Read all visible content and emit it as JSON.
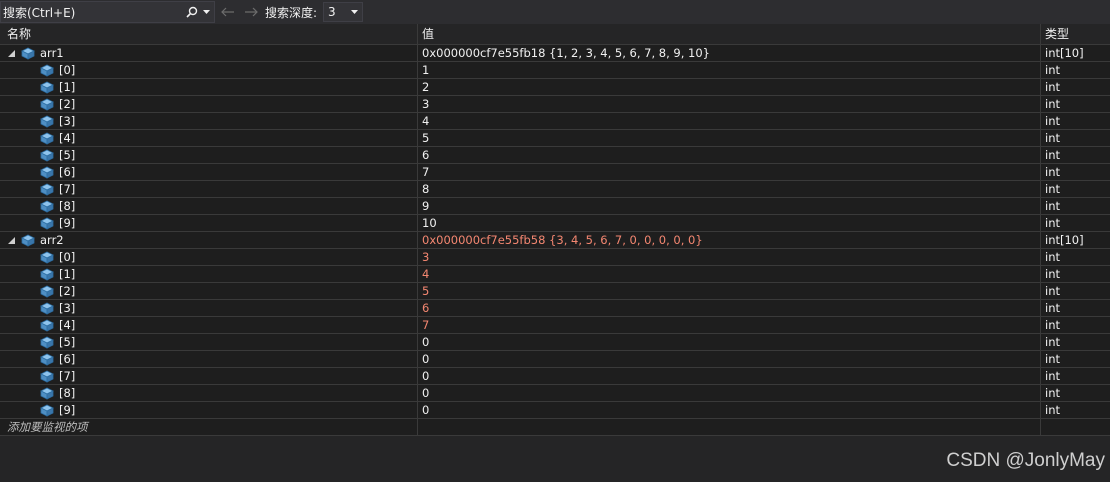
{
  "toolbar": {
    "search_placeholder": "搜索(Ctrl+E)",
    "depth_label": "搜索深度:",
    "depth_value": "3"
  },
  "columns": {
    "name": "名称",
    "value": "值",
    "type": "类型"
  },
  "rows": [
    {
      "name": "arr1",
      "value": "0x000000cf7e55fb18 {1, 2, 3, 4, 5, 6, 7, 8, 9, 10}",
      "type": "int[10]",
      "level": 0,
      "changed": false
    },
    {
      "name": "[0]",
      "value": "1",
      "type": "int",
      "level": 1,
      "changed": false
    },
    {
      "name": "[1]",
      "value": "2",
      "type": "int",
      "level": 1,
      "changed": false
    },
    {
      "name": "[2]",
      "value": "3",
      "type": "int",
      "level": 1,
      "changed": false
    },
    {
      "name": "[3]",
      "value": "4",
      "type": "int",
      "level": 1,
      "changed": false
    },
    {
      "name": "[4]",
      "value": "5",
      "type": "int",
      "level": 1,
      "changed": false
    },
    {
      "name": "[5]",
      "value": "6",
      "type": "int",
      "level": 1,
      "changed": false
    },
    {
      "name": "[6]",
      "value": "7",
      "type": "int",
      "level": 1,
      "changed": false
    },
    {
      "name": "[7]",
      "value": "8",
      "type": "int",
      "level": 1,
      "changed": false
    },
    {
      "name": "[8]",
      "value": "9",
      "type": "int",
      "level": 1,
      "changed": false
    },
    {
      "name": "[9]",
      "value": "10",
      "type": "int",
      "level": 1,
      "changed": false
    },
    {
      "name": "arr2",
      "value": "0x000000cf7e55fb58 {3, 4, 5, 6, 7, 0, 0, 0, 0, 0}",
      "type": "int[10]",
      "level": 0,
      "changed": true
    },
    {
      "name": "[0]",
      "value": "3",
      "type": "int",
      "level": 1,
      "changed": true
    },
    {
      "name": "[1]",
      "value": "4",
      "type": "int",
      "level": 1,
      "changed": true
    },
    {
      "name": "[2]",
      "value": "5",
      "type": "int",
      "level": 1,
      "changed": true
    },
    {
      "name": "[3]",
      "value": "6",
      "type": "int",
      "level": 1,
      "changed": true
    },
    {
      "name": "[4]",
      "value": "7",
      "type": "int",
      "level": 1,
      "changed": true
    },
    {
      "name": "[5]",
      "value": "0",
      "type": "int",
      "level": 1,
      "changed": false
    },
    {
      "name": "[6]",
      "value": "0",
      "type": "int",
      "level": 1,
      "changed": false
    },
    {
      "name": "[7]",
      "value": "0",
      "type": "int",
      "level": 1,
      "changed": false
    },
    {
      "name": "[8]",
      "value": "0",
      "type": "int",
      "level": 1,
      "changed": false
    },
    {
      "name": "[9]",
      "value": "0",
      "type": "int",
      "level": 1,
      "changed": false
    }
  ],
  "add_watch_label": "添加要监视的项",
  "watermark": "CSDN @JonlyMay",
  "colors": {
    "background": "#1e1e1e",
    "changed_value": "#f48771",
    "icon_blue": "#6aa9dc"
  },
  "icons": {
    "search": "magnifier-icon",
    "back": "arrow-left-icon",
    "forward": "arrow-right-icon",
    "variable": "object-cube-icon",
    "expander": "triangle-expanded-icon"
  }
}
